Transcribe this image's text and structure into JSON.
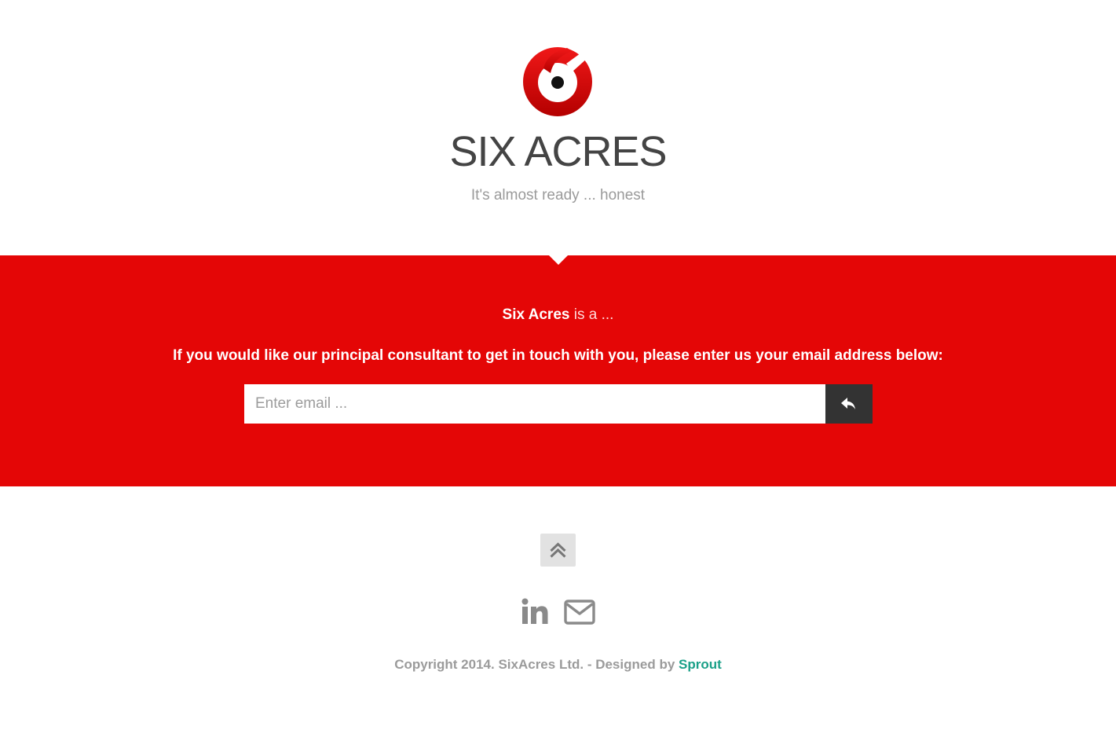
{
  "header": {
    "logo_icon": "six-acres-logo-icon",
    "title": "SIX ACRES",
    "tagline": "It's almost ready ... honest"
  },
  "band": {
    "background_color": "#e40606",
    "intro_brand": "Six Acres",
    "intro_rest": " is a ...",
    "prompt": "If you would like our principal consultant to get in touch with you, please enter us your email address below:",
    "email_placeholder": "Enter email ...",
    "submit_icon": "reply-arrow-icon"
  },
  "footer": {
    "back_to_top_icon": "double-chevron-up-icon",
    "social": [
      {
        "name": "LinkedIn",
        "icon": "linkedin-icon"
      },
      {
        "name": "Email",
        "icon": "envelope-icon"
      }
    ],
    "copyright_text": "Copyright 2014. SixAcres Ltd. - Designed by ",
    "designer_link": "Sprout",
    "link_color": "#1aa088"
  }
}
